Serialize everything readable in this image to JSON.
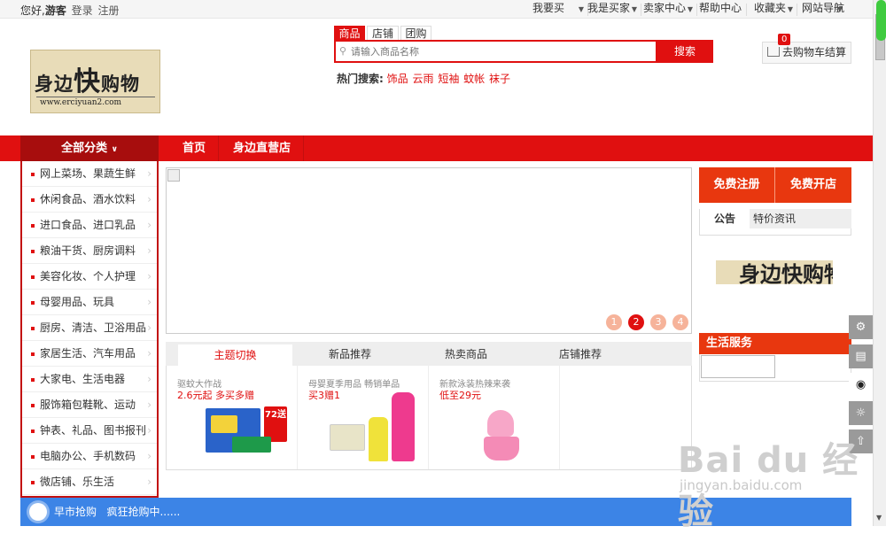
{
  "topbar": {
    "greeting": "您好,",
    "guest": "游客",
    "login": "登录",
    "register": "注册",
    "menus": [
      "我要买",
      "我是买家",
      "卖家中心",
      "帮助中心",
      "收藏夹",
      "网站导航"
    ]
  },
  "logo": {
    "title_a": "身边",
    "title_b": "快",
    "title_c": "购物",
    "url": "www.erciyuan2.com"
  },
  "search": {
    "tabs": [
      "商品",
      "店铺",
      "团购"
    ],
    "placeholder": "请输入商品名称",
    "button": "搜索",
    "hot_label": "热门搜索:",
    "hot_keywords": [
      "饰品",
      "云雨",
      "短袖",
      "蚊帐",
      "袜子"
    ]
  },
  "cart": {
    "label": "去购物车结算",
    "count": "0"
  },
  "nav": {
    "all_categories": "全部分类",
    "items": [
      "首页",
      "身边直营店"
    ]
  },
  "categories": [
    "网上菜场、果蔬生鲜",
    "休闲食品、酒水饮料",
    "进口食品、进口乳品",
    "粮油干货、厨房调料",
    "美容化妆、个人护理",
    "母婴用品、玩具",
    "厨房、清洁、卫浴用品",
    "家居生活、汽车用品",
    "大家电、生活电器",
    "服饰箱包鞋靴、运动",
    "钟表、礼品、图书报刊",
    "电脑办公、手机数码",
    "微店铺、乐生活"
  ],
  "carousel": {
    "pages": [
      "1",
      "2",
      "3",
      "4"
    ],
    "active_page": 2
  },
  "product_tabs": [
    "主题切换",
    "新品推荐",
    "热卖商品",
    "店铺推荐"
  ],
  "products": [
    {
      "line1": "驱蚊大作战",
      "line2": "2.6元起 多买多赠",
      "badge": "72送"
    },
    {
      "line1": "母婴夏季用品 畅销单品",
      "line2": "买3赠1"
    },
    {
      "line1": "新款泳装热辣来袭",
      "line2": "低至29元"
    }
  ],
  "right_panel": {
    "register": "免费注册",
    "open_shop": "免费开店",
    "notice_tab": "公告",
    "deals_tab": "特价资讯",
    "life_service": "生活服务"
  },
  "side_icons": [
    "gear-icon",
    "note-icon",
    "qq-icon",
    "weibo-icon",
    "top-icon"
  ],
  "flash_sale": {
    "title": "早市抢购",
    "text": "疯狂抢购中......"
  },
  "watermark": {
    "main": "Bai du 经验",
    "sub": "jingyan.baidu.com"
  },
  "colors": {
    "accent": "#e01010",
    "dark_accent": "#a70d0d",
    "orange": "#e8370f",
    "blue_bar": "#3c84e6"
  }
}
